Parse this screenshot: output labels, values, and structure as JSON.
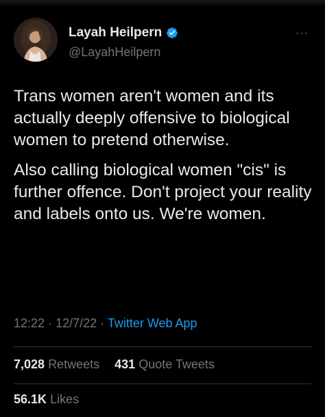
{
  "author": {
    "display_name": "Layah Heilpern",
    "handle": "@LayahHeilpern",
    "verified_color": "#1d9bf0"
  },
  "tweet": {
    "paragraphs": [
      "Trans women aren't women and its actually deeply offensive to biological women to pretend otherwise.",
      "Also calling biological women \"cis\" is further offence. Don't project your reality and labels onto us. We're women."
    ],
    "time": "12:22",
    "date": "12/7/22",
    "separator": "·",
    "source": "Twitter Web App"
  },
  "stats": {
    "retweets_count": "7,028",
    "retweets_label": "Retweets",
    "quote_count": "431",
    "quote_label": "Quote Tweets",
    "likes_count": "56.1K",
    "likes_label": "Likes"
  },
  "more_icon": "···",
  "colors": {
    "background": "#000000",
    "text": "#e7e9ea",
    "secondary": "#71767b",
    "accent": "#1d9bf0",
    "divider": "#2f3336"
  }
}
